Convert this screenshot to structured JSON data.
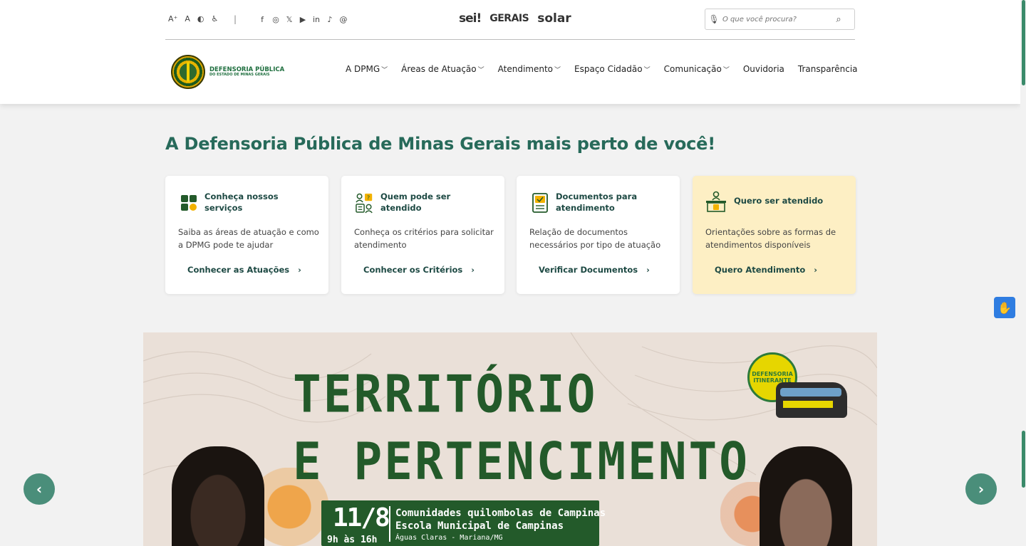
{
  "accessibility": {
    "increase_font": "A⁺",
    "decrease_font": "A",
    "contrast": "◐",
    "accessibility": "♿"
  },
  "divider": "|",
  "social": [
    "f",
    "◎",
    "𝕏",
    "▶",
    "in",
    "♪",
    "@"
  ],
  "brands": {
    "sei": "sei!",
    "gerais": "GERAIS",
    "solar": "solar"
  },
  "search": {
    "placeholder": "O que você procura?"
  },
  "logo": {
    "line1": "DEFENSORIA PÚBLICA",
    "line2": "DO ESTADO DE MINAS GERAIS"
  },
  "nav": [
    {
      "label": "A DPMG",
      "chevron": true
    },
    {
      "label": "Áreas de Atuação",
      "chevron": true
    },
    {
      "label": "Atendimento",
      "chevron": true
    },
    {
      "label": "Espaço Cidadão",
      "chevron": true
    },
    {
      "label": "Comunicação",
      "chevron": true
    },
    {
      "label": "Ouvidoria",
      "chevron": false
    },
    {
      "label": "Transparência",
      "chevron": false
    }
  ],
  "headline": "A Defensoria Pública de Minas Gerais mais perto de você!",
  "cards": [
    {
      "title": "Conheça nossos serviços",
      "desc": "Saiba as áreas de atuação e como a DPMG pode te ajudar",
      "link": "Conhecer as Atuações"
    },
    {
      "title": "Quem pode ser atendido",
      "desc": "Conheça os critérios para solicitar atendimento",
      "link": "Conhecer os Critérios"
    },
    {
      "title": "Documentos para atendimento",
      "desc": "Relação de documentos necessários por tipo de atuação",
      "link": "Verificar Documentos"
    },
    {
      "title": "Quero ser atendido",
      "desc": "Orientações sobre as formas de atendimentos disponíveis",
      "link": "Quero Atendimento"
    }
  ],
  "banner": {
    "title_line1": "TERRITÓRIO",
    "title_line2": "E PERTENCIMENTO",
    "date": "11/8",
    "time": "9h às 16h",
    "line1": "Comunidades quilombolas de Campinas",
    "line2": "Escola Municipal de Campinas",
    "line3": "Águas Claras - Mariana/MG",
    "badge": "DEFENSORIA ITINERANTE"
  },
  "slider": {
    "prev": "‹",
    "next": "›"
  },
  "colors": {
    "accent": "#276a5a",
    "highlight_card": "#fdefc4",
    "banner_green": "#235a2a",
    "slider_btn": "#4a8e7a",
    "vlibras": "#2f7de1"
  }
}
